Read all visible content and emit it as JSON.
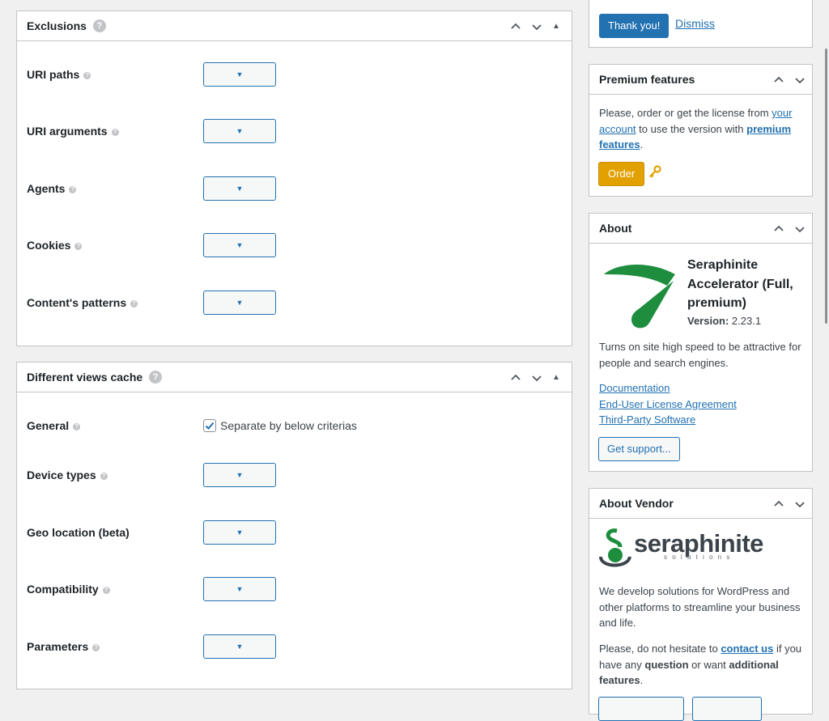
{
  "exclusions": {
    "title": "Exclusions",
    "rows": [
      {
        "label": "URI paths"
      },
      {
        "label": "URI arguments"
      },
      {
        "label": "Agents"
      },
      {
        "label": "Cookies"
      },
      {
        "label": "Content's patterns"
      }
    ]
  },
  "views_cache": {
    "title": "Different views cache",
    "general_label": "General",
    "general_checkbox": "Separate by below criterias",
    "rows": [
      {
        "label": "Device types"
      },
      {
        "label": "Geo location (beta)"
      },
      {
        "label": "Compatibility"
      },
      {
        "label": "Parameters"
      }
    ]
  },
  "notice": {
    "thank_you": "Thank you!",
    "dismiss": "Dismiss"
  },
  "premium": {
    "title": "Premium features",
    "text_1": "Please, order or get the license from ",
    "link_your": "your",
    "link_account": "account",
    "text_2": " to use the version with ",
    "link_premium": "premium",
    "link_features": "features",
    "text_3": ".",
    "order_button": "Order"
  },
  "about": {
    "title": "About",
    "product_name_1": "Seraphinite",
    "product_name_2": "Accelerator (Full,",
    "product_name_3": "premium)",
    "version_label": "Version:",
    "version_value": "2.23.1",
    "description": "Turns on site high speed to be attractive for people and search engines.",
    "links": [
      "Documentation",
      "End-User License Agreement",
      "Third-Party Software"
    ],
    "support_button": "Get support..."
  },
  "vendor": {
    "title": "About Vendor",
    "logo_name": "seraphinite",
    "logo_sub": "s o l u t i o n s",
    "description": "We develop solutions for WordPress and other platforms to streamline your business and life.",
    "contact_1": "Please, do not hesitate to ",
    "contact_link": "contact us",
    "contact_2": " if you have any ",
    "contact_bold_1": "question",
    "contact_3": " or want ",
    "contact_bold_2": "additional features",
    "contact_4": "."
  },
  "colors": {
    "primary": "#2271b1",
    "order": "#e2a100",
    "logo_green": "#1e8e3e"
  }
}
